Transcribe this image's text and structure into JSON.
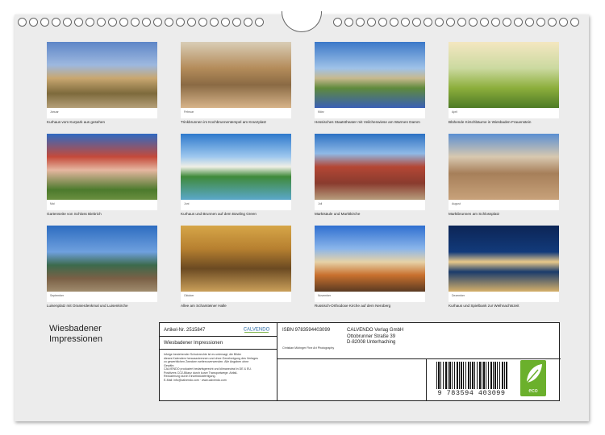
{
  "title": {
    "line1": "Wiesbadener",
    "line2": "Impressionen"
  },
  "months": [
    {
      "month": "Januar",
      "caption": "Kurhaus vom Kurpark aus gesehen"
    },
    {
      "month": "Februar",
      "caption": "Trinkbrunnen im Kochbrunnentempel am Kranzplatz"
    },
    {
      "month": "März",
      "caption": "Hessisches Staatstheater mit Veilchenwiese am Warmen Damm"
    },
    {
      "month": "April",
      "caption": "Blühende Kirschbäume in Wiesbaden-Frauenstein"
    },
    {
      "month": "Mai",
      "caption": "Gartenseite von Schloss Biebrich"
    },
    {
      "month": "Juni",
      "caption": "Kurhaus und Brunnen auf dem Bowling Green"
    },
    {
      "month": "Juli",
      "caption": "Marktsäule und Marktkirche"
    },
    {
      "month": "August",
      "caption": "Marktbrunnen am Schlossplatz"
    },
    {
      "month": "September",
      "caption": "Luisenplatz mit Oranierdenkmal und Luisenkirche"
    },
    {
      "month": "Oktober",
      "caption": "Allee am Scharsteiner Halle"
    },
    {
      "month": "November",
      "caption": "Russisch-Orthodoxe Kirche auf dem Neroberg"
    },
    {
      "month": "Dezember",
      "caption": "Kurhaus und Spielbank zur Weihnachtszeit"
    }
  ],
  "info": {
    "article": "Artikel-Nr. 2515847",
    "calvendo_logo": "CALVENDO",
    "title": "Wiesbadener Impressionen",
    "isbn": "ISBN 9783594403099",
    "author": "Christian Müringer Fine Art Photography",
    "publisher": [
      "CALVENDO Verlag GmbH",
      "Ottobrunner Straße 39",
      "D-82008 Unterhaching"
    ],
    "legal": [
      "Infolge bestehender Schutzrechte ist es untersagt, die Bilder",
      "dieses Kalenders herauszutrennen und ohne Genehmigung des Verlages",
      "zu gewerblichen Zwecken weiterzuverwenden. Alle Angaben ohne",
      "Gewähr.",
      "CALVENDO produziert bedarfsgerecht und klimaneutral in DE & EU.",
      "Positivers CO2-Bilanz durch kurze Transportwege. Abfall-",
      "Reduzierung durch Einzelstückfertigung.",
      "E-Mail: info@calvendo.com · www.calvendo.com"
    ],
    "barcode_digits": "9 783594 403099",
    "eco_label": "eco"
  },
  "colors": {
    "eco_green": "#6bb02c",
    "sheet": "#ececec"
  }
}
